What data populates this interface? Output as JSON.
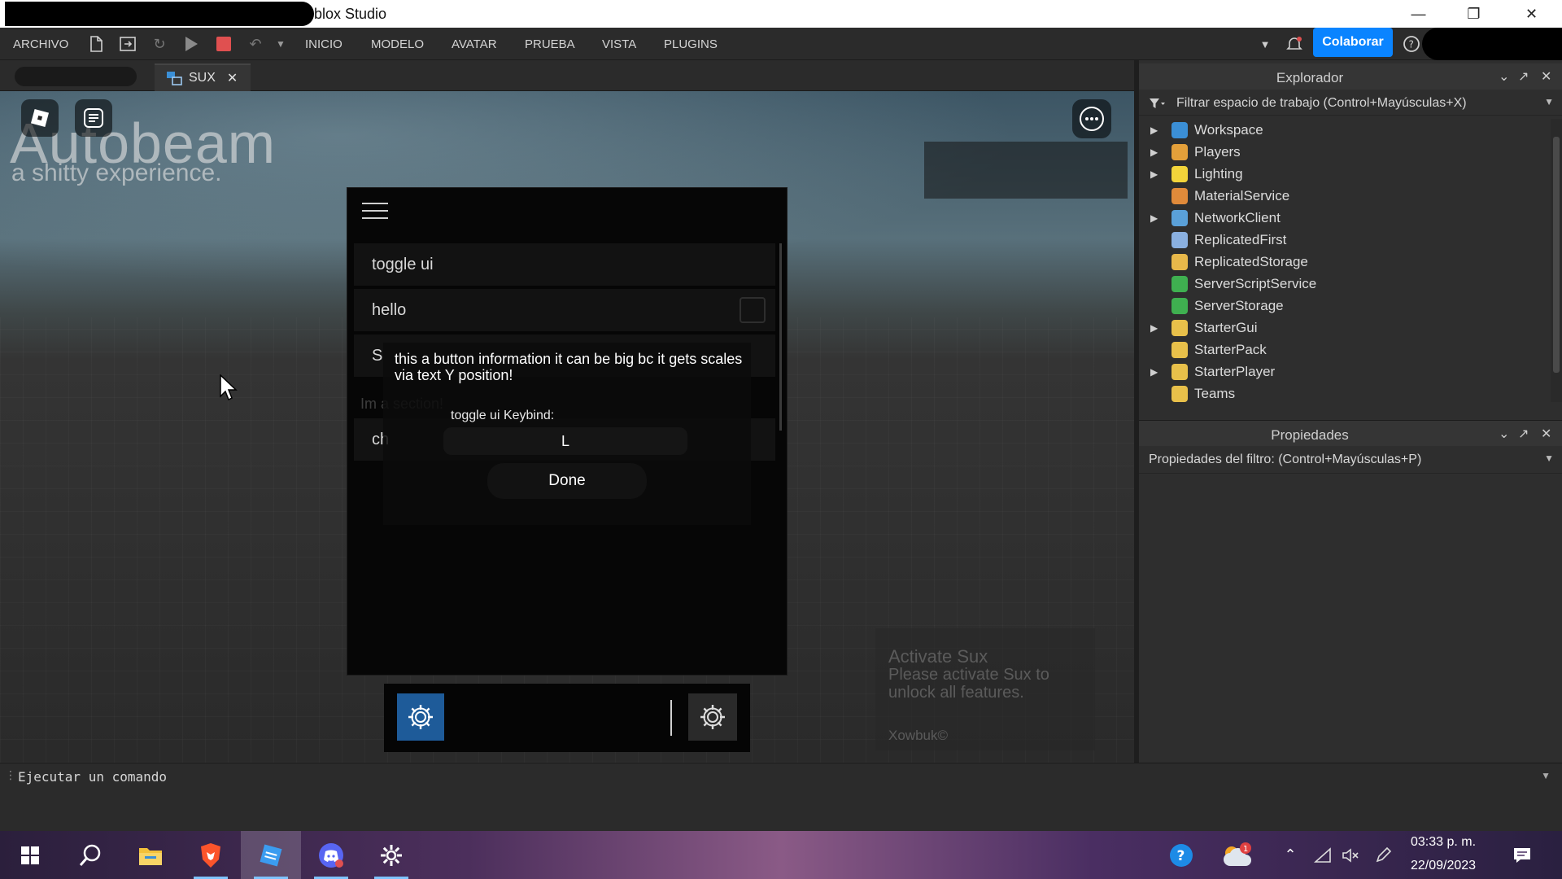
{
  "window": {
    "title": "blox Studio"
  },
  "ribbon": {
    "file_menu": "ARCHIVO",
    "tabs": [
      "INICIO",
      "MODELO",
      "AVATAR",
      "PRUEBA",
      "VISTA",
      "PLUGINS"
    ],
    "collaborate": "Colaborar"
  },
  "document_tab": {
    "label": "SUX"
  },
  "viewport": {
    "brand_title": "Autobeam",
    "brand_subtitle": "a shitty experience."
  },
  "sux_ui": {
    "rows": [
      "toggle ui",
      "hello",
      "S",
      "ch"
    ],
    "section_label": "Im a section!",
    "tooltip": "this a button information it can be big bc it gets scales via text Y position!",
    "keybind_label": "toggle ui Keybind:",
    "keybind_value": "L",
    "done_label": "Done",
    "watermark": {
      "title": "Activate Sux",
      "message": "Please activate Sux to unlock all features.",
      "credit": "Xowbuk©"
    }
  },
  "explorer": {
    "title": "Explorador",
    "filter": "Filtrar espacio de trabajo (Control+Mayúsculas+X)",
    "items": [
      {
        "name": "Workspace",
        "expandable": true,
        "color": "#3b8fd6"
      },
      {
        "name": "Players",
        "expandable": true,
        "color": "#e4a03a"
      },
      {
        "name": "Lighting",
        "expandable": true,
        "color": "#f2d43a"
      },
      {
        "name": "MaterialService",
        "expandable": false,
        "color": "#e08a3a"
      },
      {
        "name": "NetworkClient",
        "expandable": true,
        "color": "#5aa0d8"
      },
      {
        "name": "ReplicatedFirst",
        "expandable": false,
        "color": "#8ab0e0"
      },
      {
        "name": "ReplicatedStorage",
        "expandable": false,
        "color": "#e8b84a"
      },
      {
        "name": "ServerScriptService",
        "expandable": false,
        "color": "#3fb050"
      },
      {
        "name": "ServerStorage",
        "expandable": false,
        "color": "#3fb050"
      },
      {
        "name": "StarterGui",
        "expandable": true,
        "color": "#e8c04a"
      },
      {
        "name": "StarterPack",
        "expandable": false,
        "color": "#e8c04a"
      },
      {
        "name": "StarterPlayer",
        "expandable": true,
        "color": "#e8c04a"
      },
      {
        "name": "Teams",
        "expandable": false,
        "color": "#e8c04a"
      }
    ]
  },
  "properties": {
    "title": "Propiedades",
    "filter": "Propiedades del filtro: (Control+Mayúsculas+P)"
  },
  "command_bar": {
    "placeholder": "Ejecutar un comando"
  },
  "taskbar": {
    "time": "03:33 p. m.",
    "date": "22/09/2023",
    "notification_count": "1"
  }
}
